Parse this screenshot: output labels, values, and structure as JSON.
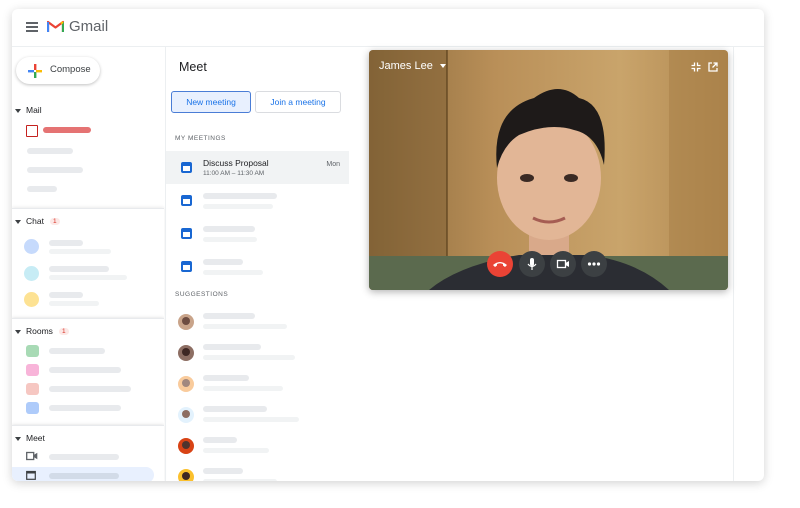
{
  "app": {
    "title": "Gmail",
    "menu_icon": "menu-icon",
    "logo_icon": "gmail-logo-icon"
  },
  "compose": {
    "label": "Compose",
    "icon": "compose-plus-icon"
  },
  "sidebar": {
    "mail": {
      "label": "Mail"
    },
    "chat": {
      "label": "Chat",
      "badge": "1"
    },
    "rooms": {
      "label": "Rooms",
      "badge": "1"
    },
    "meet": {
      "label": "Meet"
    }
  },
  "meet": {
    "title": "Meet",
    "new_meeting_label": "New meeting",
    "join_meeting_label": "Join a meeting",
    "my_meetings_label": "MY MEETINGS",
    "suggestions_label": "SUGGESTIONS",
    "meetings": [
      {
        "name": "Discuss Proposal",
        "time": "11:00 AM – 11:30 AM",
        "day": "Mon"
      }
    ]
  },
  "video": {
    "participant": "James Lee",
    "controls": [
      "end-call-icon",
      "mic-icon",
      "camera-icon",
      "more-icon"
    ]
  },
  "colors": {
    "accent": "#1a73e8",
    "end_call": "#ea4335",
    "badge": "#d93025",
    "mail_active": "#e57373"
  }
}
